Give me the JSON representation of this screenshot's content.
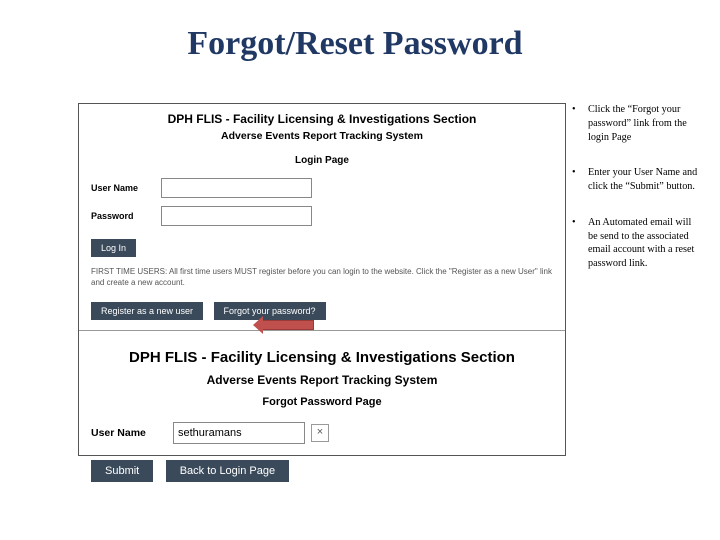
{
  "title": "Forgot/Reset Password",
  "screenshot1": {
    "header": "DPH FLIS - Facility Licensing & Investigations Section",
    "subtitle": "Adverse Events Report Tracking System",
    "pageLabel": "Login Page",
    "userNameLabel": "User Name",
    "passwordLabel": "Password",
    "loginBtn": "Log In",
    "note": "FIRST TIME USERS: All first time users MUST register before you can login to the website. Click the \"Register as a new User\" link and create a new account.",
    "registerBtn": "Register as a new user",
    "forgotBtn": "Forgot your password?"
  },
  "screenshot2": {
    "header": "DPH FLIS - Facility Licensing & Investigations Section",
    "subtitle": "Adverse Events Report Tracking System",
    "pageLabel": "Forgot Password Page",
    "userNameLabel": "User Name",
    "userNameValue": "sethuramans",
    "submitBtn": "Submit",
    "backBtn": "Back to Login Page",
    "clearGlyph": "×"
  },
  "bullets": {
    "b1": "Click the “Forgot your password” link from the login Page",
    "b2": "Enter your User Name and click the “Submit” button.",
    "b3": "An Automated email will be send to the associated email account with a reset password link."
  }
}
